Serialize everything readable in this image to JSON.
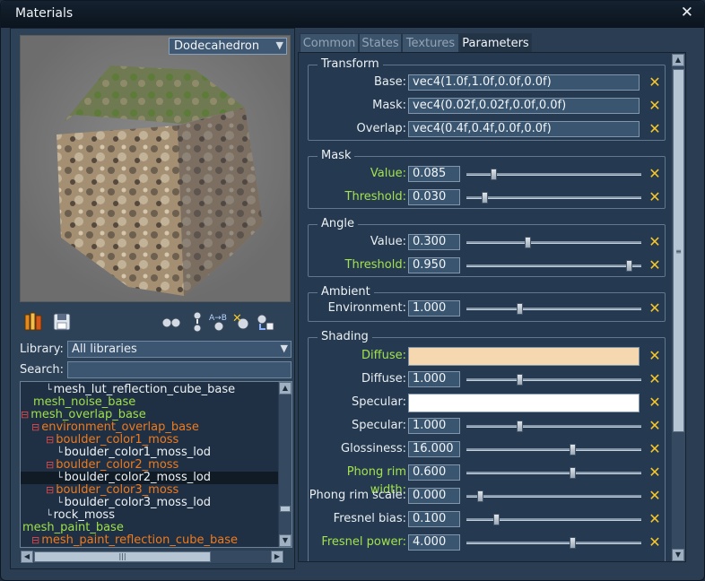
{
  "window": {
    "title": "Materials"
  },
  "preview": {
    "mesh_selected": "Dodecahedron"
  },
  "library": {
    "label": "Library:",
    "selected": "All libraries",
    "search_label": "Search:",
    "search_value": ""
  },
  "tree": {
    "items": [
      {
        "label": "mesh_lut_reflection_cube_base",
        "color": "#eef2f5",
        "prefix": "└"
      },
      {
        "label": "mesh_noise_base",
        "color": "#9ee04a",
        "prefix": ""
      },
      {
        "label": "mesh_overlap_base",
        "color": "#9ee04a",
        "prefix": "⊟"
      },
      {
        "label": "environment_overlap_base",
        "color": "#f07a1c",
        "prefix": "⊟"
      },
      {
        "label": "boulder_color1_moss",
        "color": "#f07a1c",
        "prefix": "⊟"
      },
      {
        "label": "boulder_color1_moss_lod",
        "color": "#eef2f5",
        "prefix": "└"
      },
      {
        "label": "boulder_color2_moss",
        "color": "#f07a1c",
        "prefix": "⊟"
      },
      {
        "label": "boulder_color2_moss_lod",
        "color": "#eef2f5",
        "prefix": "└"
      },
      {
        "label": "boulder_color3_moss",
        "color": "#f07a1c",
        "prefix": "⊟"
      },
      {
        "label": "boulder_color3_moss_lod",
        "color": "#eef2f5",
        "prefix": "└"
      },
      {
        "label": "rock_moss",
        "color": "#eef2f5",
        "prefix": "└"
      },
      {
        "label": "mesh_paint_base",
        "color": "#9ee04a",
        "prefix": ""
      },
      {
        "label": "mesh_paint_reflection_cube_base",
        "color": "#f07a1c",
        "prefix": "⊟"
      }
    ]
  },
  "tabs": [
    "Common",
    "States",
    "Textures",
    "Parameters"
  ],
  "groups": {
    "transform": {
      "title": "Transform",
      "base": {
        "label": "Base:",
        "value": "vec4(1.0f,1.0f,0.0f,0.0f)"
      },
      "mask": {
        "label": "Mask:",
        "value": "vec4(0.02f,0.02f,0.0f,0.0f)"
      },
      "overlap": {
        "label": "Overlap:",
        "value": "vec4(0.4f,0.4f,0.0f,0.0f)"
      }
    },
    "mask": {
      "title": "Mask",
      "value": {
        "label": "Value:",
        "value": "0.085",
        "slider": 0.085
      },
      "threshold": {
        "label": "Threshold:",
        "value": "0.030",
        "slider": 0.03
      }
    },
    "angle": {
      "title": "Angle",
      "value": {
        "label": "Value:",
        "value": "0.300",
        "slider": 0.3
      },
      "threshold": {
        "label": "Threshold:",
        "value": "0.950",
        "slider": 0.95
      }
    },
    "ambient": {
      "title": "Ambient",
      "environment": {
        "label": "Environment:",
        "value": "1.000",
        "slider": 0.25
      }
    },
    "shading": {
      "title": "Shading",
      "diffuse_color": {
        "label": "Diffuse:",
        "color": "#f5d7b0"
      },
      "diffuse": {
        "label": "Diffuse:",
        "value": "1.000",
        "slider": 0.25
      },
      "specular_color": {
        "label": "Specular:",
        "color": "#ffffff"
      },
      "specular": {
        "label": "Specular:",
        "value": "1.000",
        "slider": 0.25
      },
      "glossiness": {
        "label": "Glossiness:",
        "value": "16.000",
        "slider": 0.59
      },
      "phong_rim_width": {
        "label": "Phong rim width:",
        "value": "0.600",
        "slider": 0.59
      },
      "phong_rim_scale": {
        "label": "Phong rim scale:",
        "value": "0.000",
        "slider": 0.0
      },
      "fresnel_bias": {
        "label": "Fresnel bias:",
        "value": "0.100",
        "slider": 0.1
      },
      "fresnel_power": {
        "label": "Fresnel power:",
        "value": "4.000",
        "slider": 0.59
      }
    }
  },
  "colors": {
    "highlight_label": "#a2e24c",
    "clear_button": "#f6c62a",
    "tree_green": "#9ee04a",
    "tree_orange": "#f07a1c"
  }
}
